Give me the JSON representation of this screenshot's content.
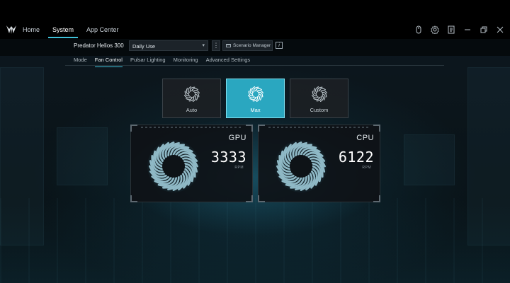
{
  "app": {
    "nav": [
      "Home",
      "System",
      "App Center"
    ],
    "active_nav": "System"
  },
  "toolbar": {
    "model": "Predator Helios 300",
    "profile": "Daily Use",
    "scenario_label": "Scenario Manager",
    "info_glyph": "i"
  },
  "tabs": [
    "Mode",
    "Fan Control",
    "Pulsar Lighting",
    "Monitoring",
    "Advanced Settings"
  ],
  "active_tab": "Fan Control",
  "fan_modes": [
    {
      "label": "Auto",
      "active": false
    },
    {
      "label": "Max",
      "active": true
    },
    {
      "label": "Custom",
      "active": false
    }
  ],
  "fans": [
    {
      "name": "GPU",
      "rpm": "3333",
      "unit": "RPM"
    },
    {
      "name": "CPU",
      "rpm": "6122",
      "unit": "RPM"
    }
  ],
  "icons": {
    "logo": "predator-logo-icon",
    "window": [
      "controller-icon",
      "settings-gear-icon",
      "notes-icon",
      "minimize-icon",
      "restore-icon",
      "close-icon"
    ]
  },
  "colors": {
    "accent": "#3fc1d8",
    "active_card": "#2aa7c0",
    "background": "#0b1116"
  }
}
